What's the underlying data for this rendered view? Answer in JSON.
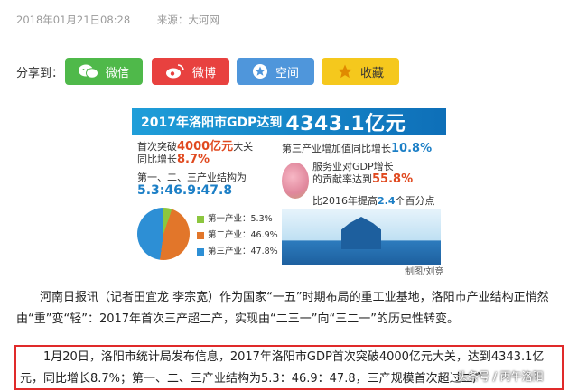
{
  "meta": {
    "date": "2018年01月21日08:28",
    "source": "来源：大河网"
  },
  "share": {
    "label": "分享到：",
    "buttons": [
      {
        "label": "微信",
        "icon": "wechat-icon",
        "color": "#4fb94a"
      },
      {
        "label": "微博",
        "icon": "weibo-icon",
        "color": "#e8413f"
      },
      {
        "label": "空间",
        "icon": "qzone-icon",
        "color": "#4f96db"
      },
      {
        "label": "收藏",
        "icon": "star-icon",
        "color": "#f5c81d"
      }
    ]
  },
  "infographic": {
    "banner_prefix": "2017年洛阳市GDP达到",
    "banner_value": "4343.1亿元",
    "l1a": "首次突破",
    "l1b": "4000亿元",
    "l1c": "大关",
    "l1d": "同比增长",
    "l1e": "8.7%",
    "l2a": "第一、二、三产业结构为",
    "l2b": "5.3:46.9:47.8",
    "r1a": "第三产业增加值同比增长",
    "r1b": "10.8%",
    "r2a": "服务业对GDP增长",
    "r2b": "的贡献率达到",
    "r2c": "55.8%",
    "r3a": "比2016年提高",
    "r3b": "2.4",
    "r3c": "个百分点",
    "legend": [
      {
        "label": "第一产业：5.3%",
        "value": 5.3,
        "color": "#8cc63f"
      },
      {
        "label": "第二产业：46.9%",
        "value": 46.9,
        "color": "#e2762a"
      },
      {
        "label": "第三产业：47.8%",
        "value": 47.8,
        "color": "#2d8fd5"
      }
    ],
    "credit": "制图/刘竞"
  },
  "article": {
    "para1": "河南日报讯（记者田宜龙 李宗宽）作为国家“一五”时期布局的重工业基地，洛阳市产业结构正悄然由“重”变“轻”：2017年首次三产超二产，实现由“二三一”向“三二一”的历史性转变。",
    "para2": "1月20日，洛阳市统计局发布信息，2017年洛阳市GDP首次突破4000亿元大关，达到4343.1亿元，同比增长8.7%；第一、二、三产业结构为5.3：46.9：47.8，三产规模首次超过二产"
  },
  "watermark": "头条号 / 丙午洛阳"
}
